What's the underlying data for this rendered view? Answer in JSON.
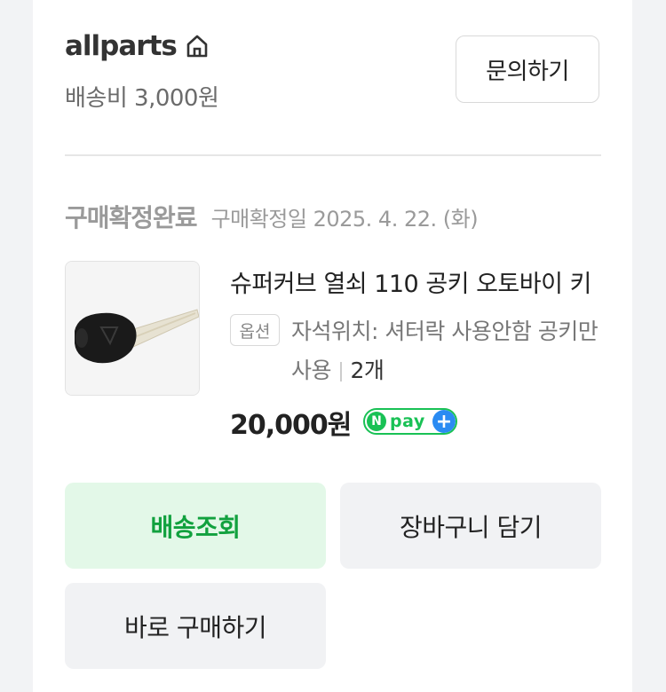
{
  "seller": {
    "name": "allparts",
    "shipping_fee": "배송비 3,000원",
    "inquiry_button": "문의하기"
  },
  "order": {
    "status": "구매확정완료",
    "confirm_date": "구매확정일 2025. 4. 22. (화)"
  },
  "product": {
    "title": "슈퍼커브 열쇠 110 공키 오토바이 키",
    "option_badge": "옵션",
    "option_text": "자석위치: 셔터락 사용안함 공키만사용",
    "quantity": "2개",
    "price": "20,000원"
  },
  "npay": {
    "n": "N",
    "pay": "pay",
    "plus": "+"
  },
  "actions": {
    "track_delivery": "배송조회",
    "add_to_cart": "장바구니 담기",
    "buy_now": "바로 구매하기"
  },
  "colors": {
    "accent_green": "#11a13e",
    "npay_green": "#19c155",
    "npay_blue": "#2a8bf2"
  },
  "icons": {
    "store": "home-icon"
  }
}
